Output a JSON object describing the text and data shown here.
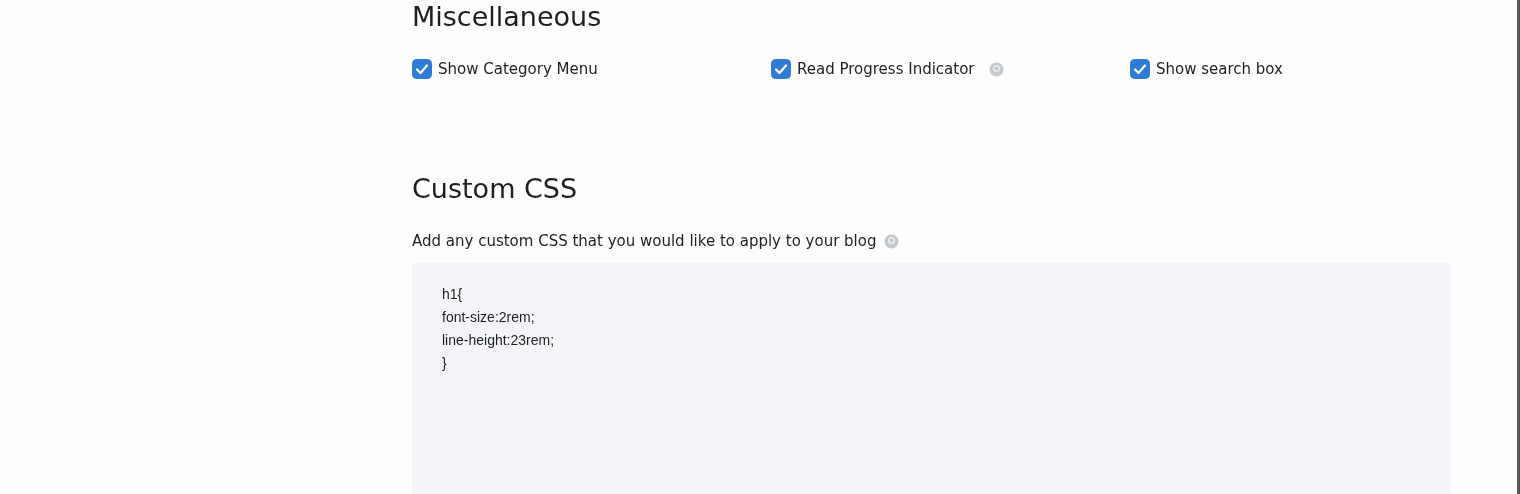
{
  "misc": {
    "heading": "Miscellaneous",
    "options": [
      {
        "label": "Show Category Menu",
        "checked": true,
        "help": false
      },
      {
        "label": "Read Progress Indicator",
        "checked": true,
        "help": true
      },
      {
        "label": "Show search box",
        "checked": true,
        "help": false
      }
    ]
  },
  "custom_css": {
    "heading": "Custom CSS",
    "description": "Add any custom CSS that you would like to apply to your blog",
    "help": true,
    "value": "h1{\nfont-size:2rem;\nline-height:23rem;\n}"
  }
}
